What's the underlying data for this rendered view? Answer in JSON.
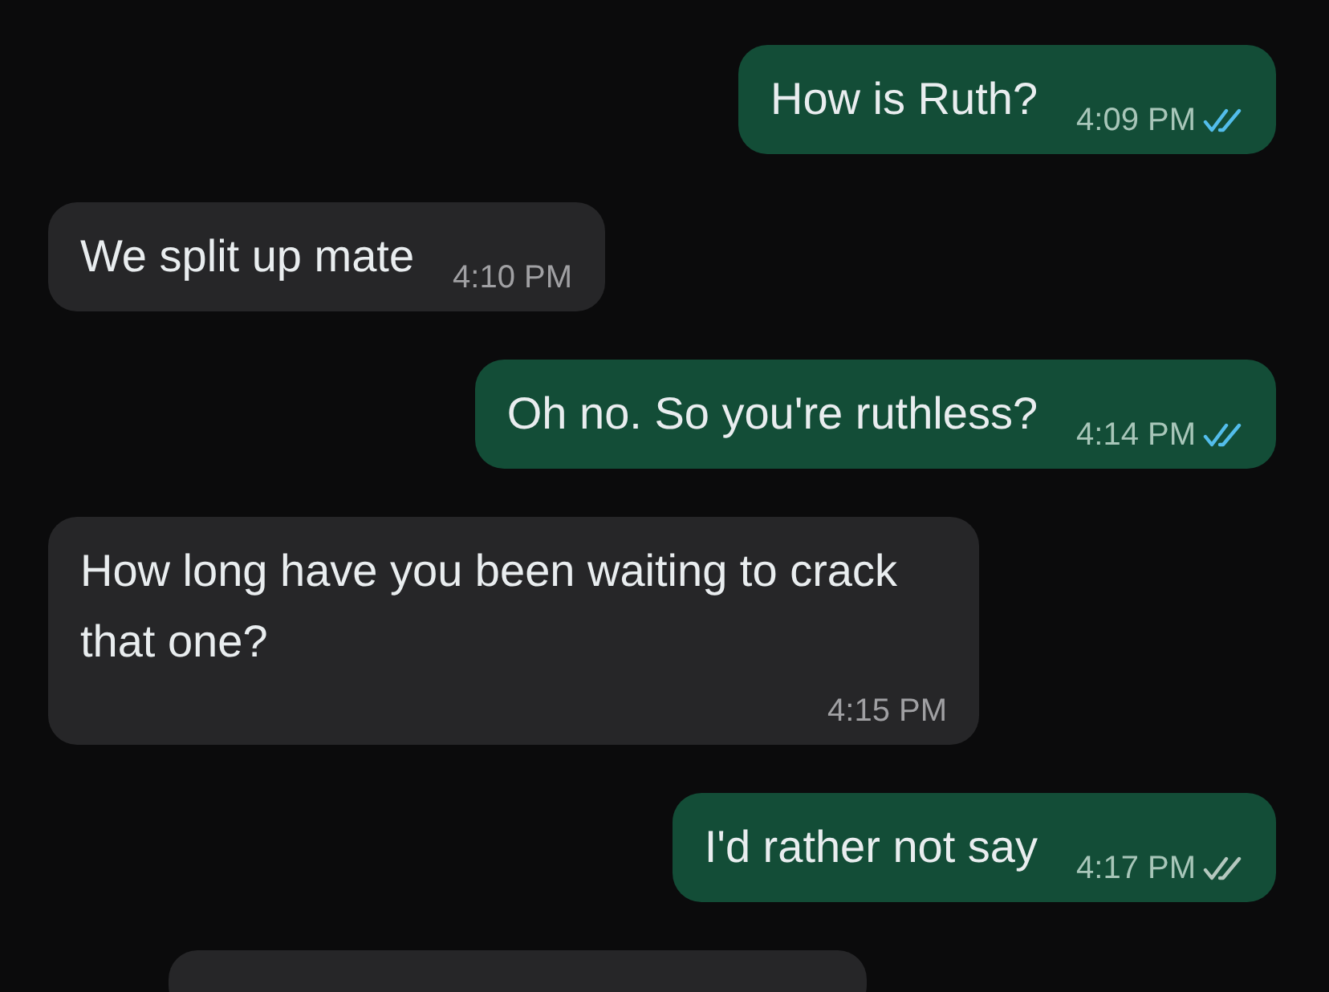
{
  "messages": [
    {
      "kind": "outgoing",
      "text": "How is Ruth?",
      "time": "4:09 PM",
      "read": true
    },
    {
      "kind": "incoming",
      "text": "We split up mate",
      "time": "4:10 PM"
    },
    {
      "kind": "outgoing",
      "text": "Oh no. So you're ruthless?",
      "time": "4:14 PM",
      "read": true
    },
    {
      "kind": "incoming",
      "text": "How long have you been waiting to crack that one?",
      "time": "4:15 PM"
    },
    {
      "kind": "outgoing",
      "text": "I'd rather not say",
      "time": "4:17 PM",
      "read": false
    }
  ]
}
